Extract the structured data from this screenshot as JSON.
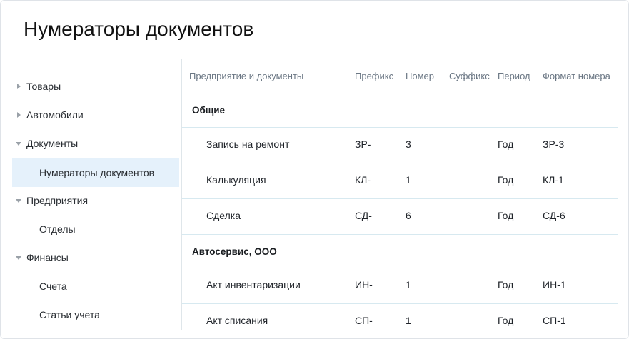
{
  "page": {
    "title": "Нумераторы документов"
  },
  "sidebar": {
    "items": [
      {
        "label": "Товары",
        "caret": "right"
      },
      {
        "label": "Автомобили",
        "caret": "right"
      },
      {
        "label": "Документы",
        "caret": "down"
      },
      {
        "label": "Нумераторы документов",
        "caret": "none",
        "selected": true
      },
      {
        "label": "Предприятия",
        "caret": "down"
      },
      {
        "label": "Отделы",
        "caret": "none"
      },
      {
        "label": "Финансы",
        "caret": "down"
      },
      {
        "label": "Счета",
        "caret": "none"
      },
      {
        "label": "Статьи учета",
        "caret": "none"
      }
    ]
  },
  "table": {
    "columns": [
      "Предприятие и документы",
      "Префикс",
      "Номер",
      "Суффикс",
      "Период",
      "Формат номера"
    ],
    "groups": [
      {
        "title": "Общие",
        "rows": [
          {
            "name": "Запись на ремонт",
            "prefix": "ЗР-",
            "number": "3",
            "suffix": "",
            "period": "Год",
            "format": "ЗР-3"
          },
          {
            "name": "Калькуляция",
            "prefix": "КЛ-",
            "number": "1",
            "suffix": "",
            "period": "Год",
            "format": "КЛ-1"
          },
          {
            "name": "Сделка",
            "prefix": "СД-",
            "number": "6",
            "suffix": "",
            "period": "Год",
            "format": "СД-6"
          }
        ]
      },
      {
        "title": "Автосервис, ООО",
        "rows": [
          {
            "name": "Акт инвентаризации",
            "prefix": "ИН-",
            "number": "1",
            "suffix": "",
            "period": "Год",
            "format": "ИН-1"
          },
          {
            "name": "Акт списания",
            "prefix": "СП-",
            "number": "1",
            "suffix": "",
            "period": "Год",
            "format": "СП-1"
          }
        ]
      }
    ]
  },
  "colors": {
    "selected_bg": "#e5f1fb",
    "divider": "#d7e9f0",
    "header_text": "#6b7784"
  }
}
